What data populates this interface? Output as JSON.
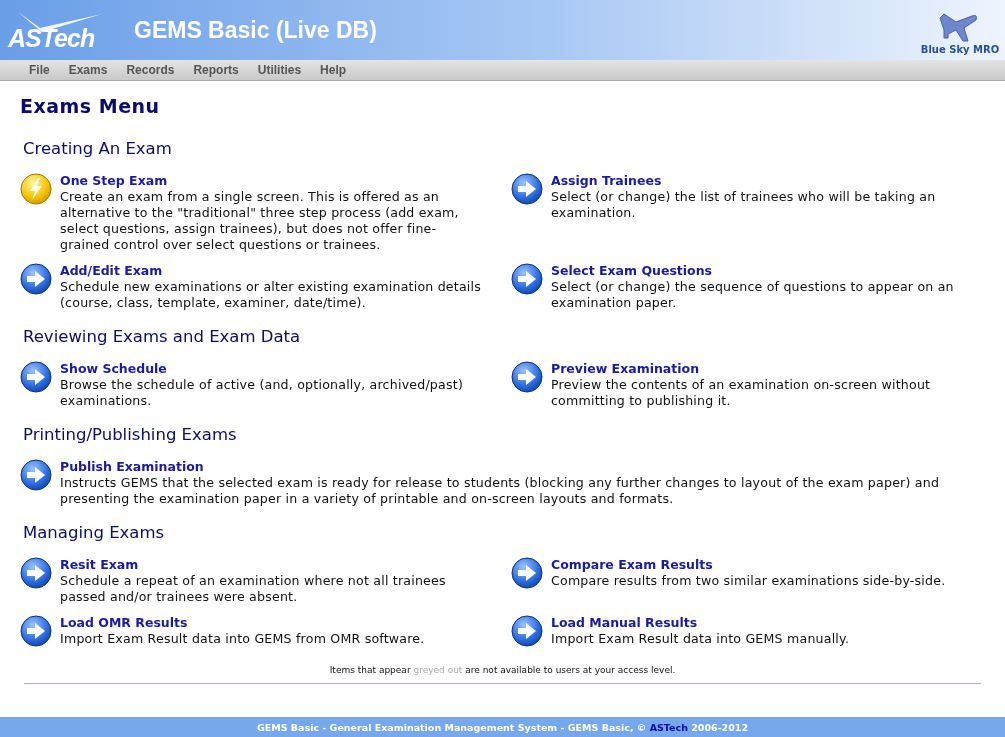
{
  "header": {
    "logo": "ASTech",
    "title": "GEMS Basic (Live DB)",
    "client": "Blue Sky MRO"
  },
  "menu": [
    {
      "label": "File"
    },
    {
      "label": "Exams"
    },
    {
      "label": "Records"
    },
    {
      "label": "Reports"
    },
    {
      "label": "Utilities"
    },
    {
      "label": "Help"
    }
  ],
  "page_title": "Exams Menu",
  "sections": [
    {
      "heading": "Creating An Exam",
      "items": [
        {
          "kind": "lightning",
          "wide": false,
          "title": "One Step Exam",
          "description": "Create an exam from a single screen. This is offered as an alternative to the \"traditional\" three step process (add exam, select questions, assign trainees), but does not offer fine-grained control over select questions or trainees."
        },
        {
          "kind": "arrow",
          "wide": false,
          "title": "Assign Trainees",
          "description": "Select (or change) the list of trainees who will be taking an examination."
        },
        {
          "kind": "arrow",
          "wide": false,
          "title": "Add/Edit Exam",
          "description": "Schedule new examinations or alter existing examination details (course, class, template, examiner, date/time)."
        },
        {
          "kind": "arrow",
          "wide": false,
          "title": "Select Exam Questions",
          "description": "Select (or change) the sequence of questions to appear on an examination paper."
        }
      ]
    },
    {
      "heading": "Reviewing Exams and Exam Data",
      "items": [
        {
          "kind": "arrow",
          "wide": false,
          "title": "Show Schedule",
          "description": "Browse the schedule of active (and, optionally, archived/past) examinations."
        },
        {
          "kind": "arrow",
          "wide": false,
          "title": "Preview Examination",
          "description": "Preview the contents of an examination on-screen without committing to publishing it."
        }
      ]
    },
    {
      "heading": "Printing/Publishing Exams",
      "items": [
        {
          "kind": "arrow",
          "wide": true,
          "title": "Publish Examination",
          "description": "Instructs GEMS that the selected exam is ready for release to students (blocking any further changes to layout of the exam paper) and presenting the examination paper in a variety of printable and on-screen layouts and formats."
        }
      ]
    },
    {
      "heading": "Managing Exams",
      "items": [
        {
          "kind": "arrow",
          "wide": false,
          "title": "Resit Exam",
          "description": "Schedule a repeat of an examination where not all trainees passed and/or trainees were absent."
        },
        {
          "kind": "arrow",
          "wide": false,
          "title": "Compare Exam Results",
          "description": "Compare results from two similar examinations side-by-side."
        },
        {
          "kind": "arrow",
          "wide": false,
          "title": "Load OMR Results",
          "description": "Import Exam Result data into GEMS from OMR software."
        },
        {
          "kind": "arrow",
          "wide": false,
          "title": "Load Manual Results",
          "description": "Import Exam Result data into GEMS manually."
        }
      ]
    }
  ],
  "note": [
    {
      "text": "Items that appear ",
      "greyed": false
    },
    {
      "text": "greyed out",
      "greyed": true
    },
    {
      "text": " are not available to users at your access level.",
      "greyed": false
    }
  ],
  "footer": [
    {
      "text": "GEMS Basic - General Examination Management System - GEMS Basic, © ",
      "highlight": false
    },
    {
      "text": "ASTech",
      "highlight": true
    },
    {
      "text": " 2006-2012",
      "highlight": false
    }
  ]
}
